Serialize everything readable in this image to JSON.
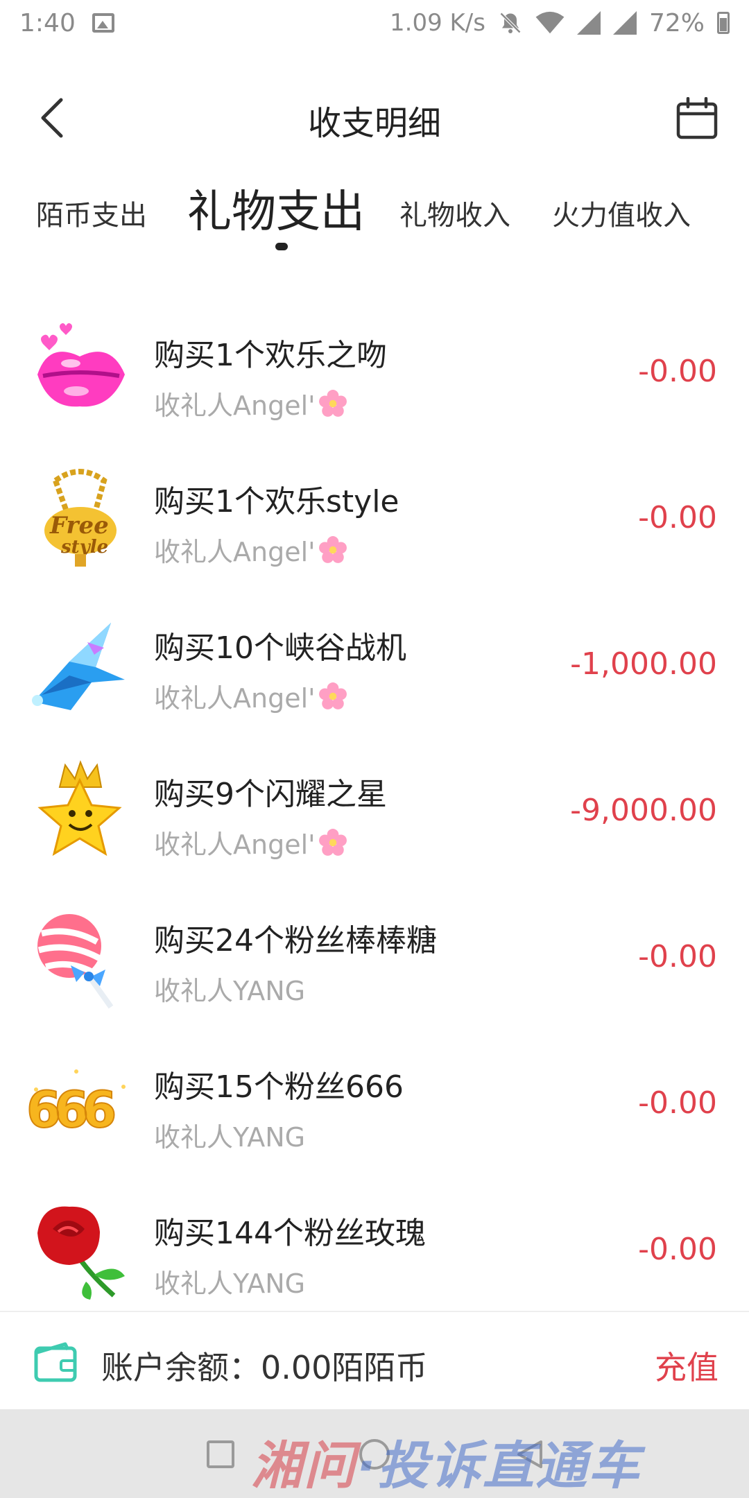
{
  "status_bar": {
    "time": "1:40",
    "speed": "1.09 K/s",
    "battery": "72%",
    "battery_level": 0.72
  },
  "header": {
    "title": "收支明细"
  },
  "tabs": [
    {
      "label": "陌币支出",
      "active": false
    },
    {
      "label": "礼物支出",
      "active": true
    },
    {
      "label": "礼物收入",
      "active": false
    },
    {
      "label": "火力值收入",
      "active": false
    }
  ],
  "transactions": [
    {
      "title": "购买1个欢乐之吻",
      "recipient": "收礼人Angel'",
      "amount": "-0.00",
      "gift_icon": "kiss-lips-icon",
      "recipient_emoji": "cherry-blossom-icon"
    },
    {
      "title": "购买1个欢乐style",
      "recipient": "收礼人Angel'",
      "amount": "-0.00",
      "gift_icon": "gold-chain-necklace-icon",
      "recipient_emoji": "cherry-blossom-icon"
    },
    {
      "title": "购买10个峡谷战机",
      "recipient": "收礼人Angel'",
      "amount": "-1,000.00",
      "gift_icon": "fighter-jet-icon",
      "recipient_emoji": "cherry-blossom-icon"
    },
    {
      "title": "购买9个闪耀之星",
      "recipient": "收礼人Angel'",
      "amount": "-9,000.00",
      "gift_icon": "crowned-star-icon",
      "recipient_emoji": "cherry-blossom-icon"
    },
    {
      "title": "购买24个粉丝棒棒糖",
      "recipient": "收礼人YANG",
      "amount": "-0.00",
      "gift_icon": "lollipop-icon",
      "recipient_emoji": ""
    },
    {
      "title": "购买15个粉丝666",
      "recipient": "收礼人YANG",
      "amount": "-0.00",
      "gift_icon": "gold-666-icon",
      "recipient_emoji": ""
    },
    {
      "title": "购买144个粉丝玫瑰",
      "recipient": "收礼人YANG",
      "amount": "-0.00",
      "gift_icon": "red-rose-icon",
      "recipient_emoji": ""
    }
  ],
  "footer": {
    "balance_text": "账户余额：0.00陌陌币",
    "recharge_label": "充值"
  },
  "watermark": {
    "part1": "湘问",
    "part2": "·投诉直通车"
  },
  "colors": {
    "amount": "#e0414c",
    "wallet": "#3ecbb0",
    "subtext": "#aaaaaa"
  }
}
